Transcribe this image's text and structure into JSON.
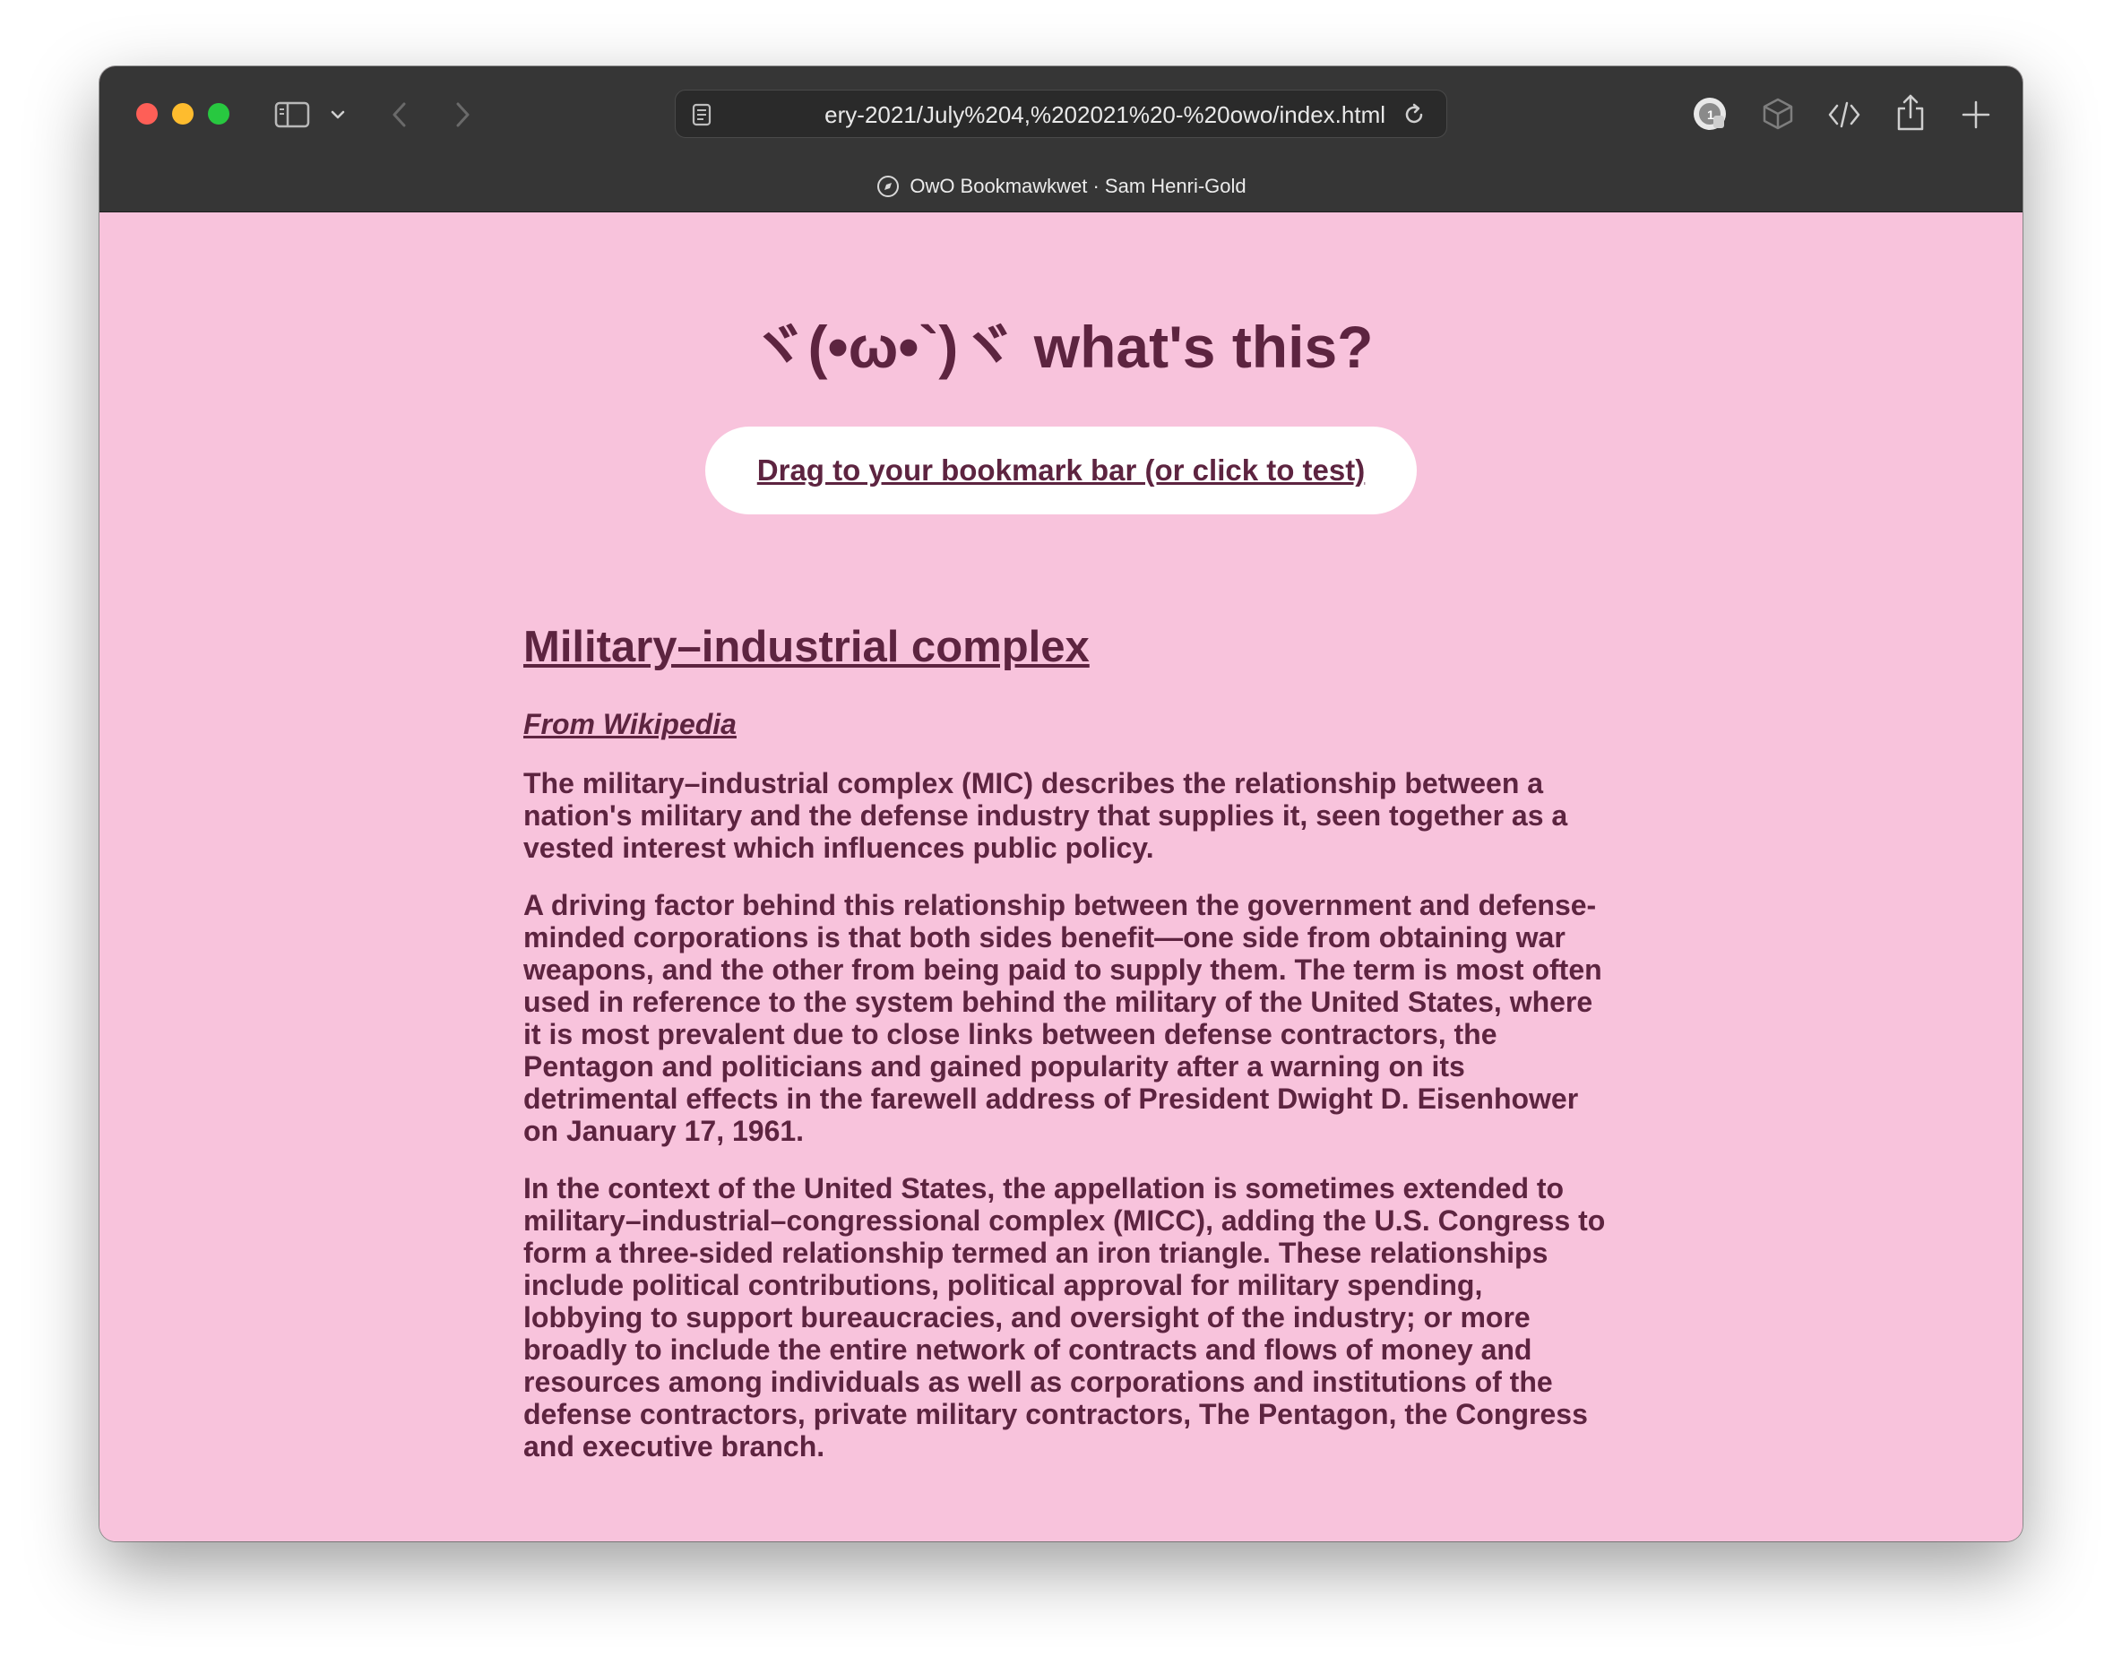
{
  "browser": {
    "url": "ery-2021/July%204,%202021%20-%20owo/index.html",
    "tab_title": "OwO Bookmawkwet · Sam Henri-Gold",
    "icons": {
      "sidebar": "sidebar-icon",
      "sidebar_menu": "chevron-down-icon",
      "back": "back-arrow-icon",
      "forward": "forward-arrow-icon",
      "reader": "reader-icon",
      "reload": "reload-icon",
      "extension": "extension-icon",
      "box": "box-icon",
      "code": "code-icon",
      "share": "share-icon",
      "new_tab": "plus-icon",
      "tab_site": "compass-icon"
    }
  },
  "page": {
    "heading": "ヾ(•ω•`)ヾ what's this?",
    "bookmarklet_label": "Drag to your bookmark bar (or click to test)",
    "article": {
      "title": "Military–industrial complex",
      "source": "From Wikipedia",
      "paragraphs": [
        "The military–industrial complex (MIC) describes the relationship between a nation's military and the defense industry that supplies it, seen together as a vested interest which influences public policy.",
        "A driving factor behind this relationship between the government and defense-minded corporations is that both sides benefit—one side from obtaining war weapons, and the other from being paid to supply them. The term is most often used in reference to the system behind the military of the United States, where it is most prevalent due to close links between defense contractors, the Pentagon and politicians and gained popularity after a warning on its detrimental effects in the farewell address of President Dwight D. Eisenhower on January 17, 1961.",
        "In the context of the United States, the appellation is sometimes extended to military–industrial–congressional complex (MICC), adding the U.S. Congress to form a three-sided relationship termed an iron triangle. These relationships include political contributions, political approval for military spending, lobbying to support bureaucracies, and oversight of the industry; or more broadly to include the entire network of contracts and flows of money and resources among individuals as well as corporations and institutions of the defense contractors, private military contractors, The Pentagon, the Congress and executive branch."
      ]
    }
  },
  "colors": {
    "page_background": "#f8c3dc",
    "text": "#5d2440",
    "toolbar": "#363636",
    "button_background": "#ffffff"
  }
}
